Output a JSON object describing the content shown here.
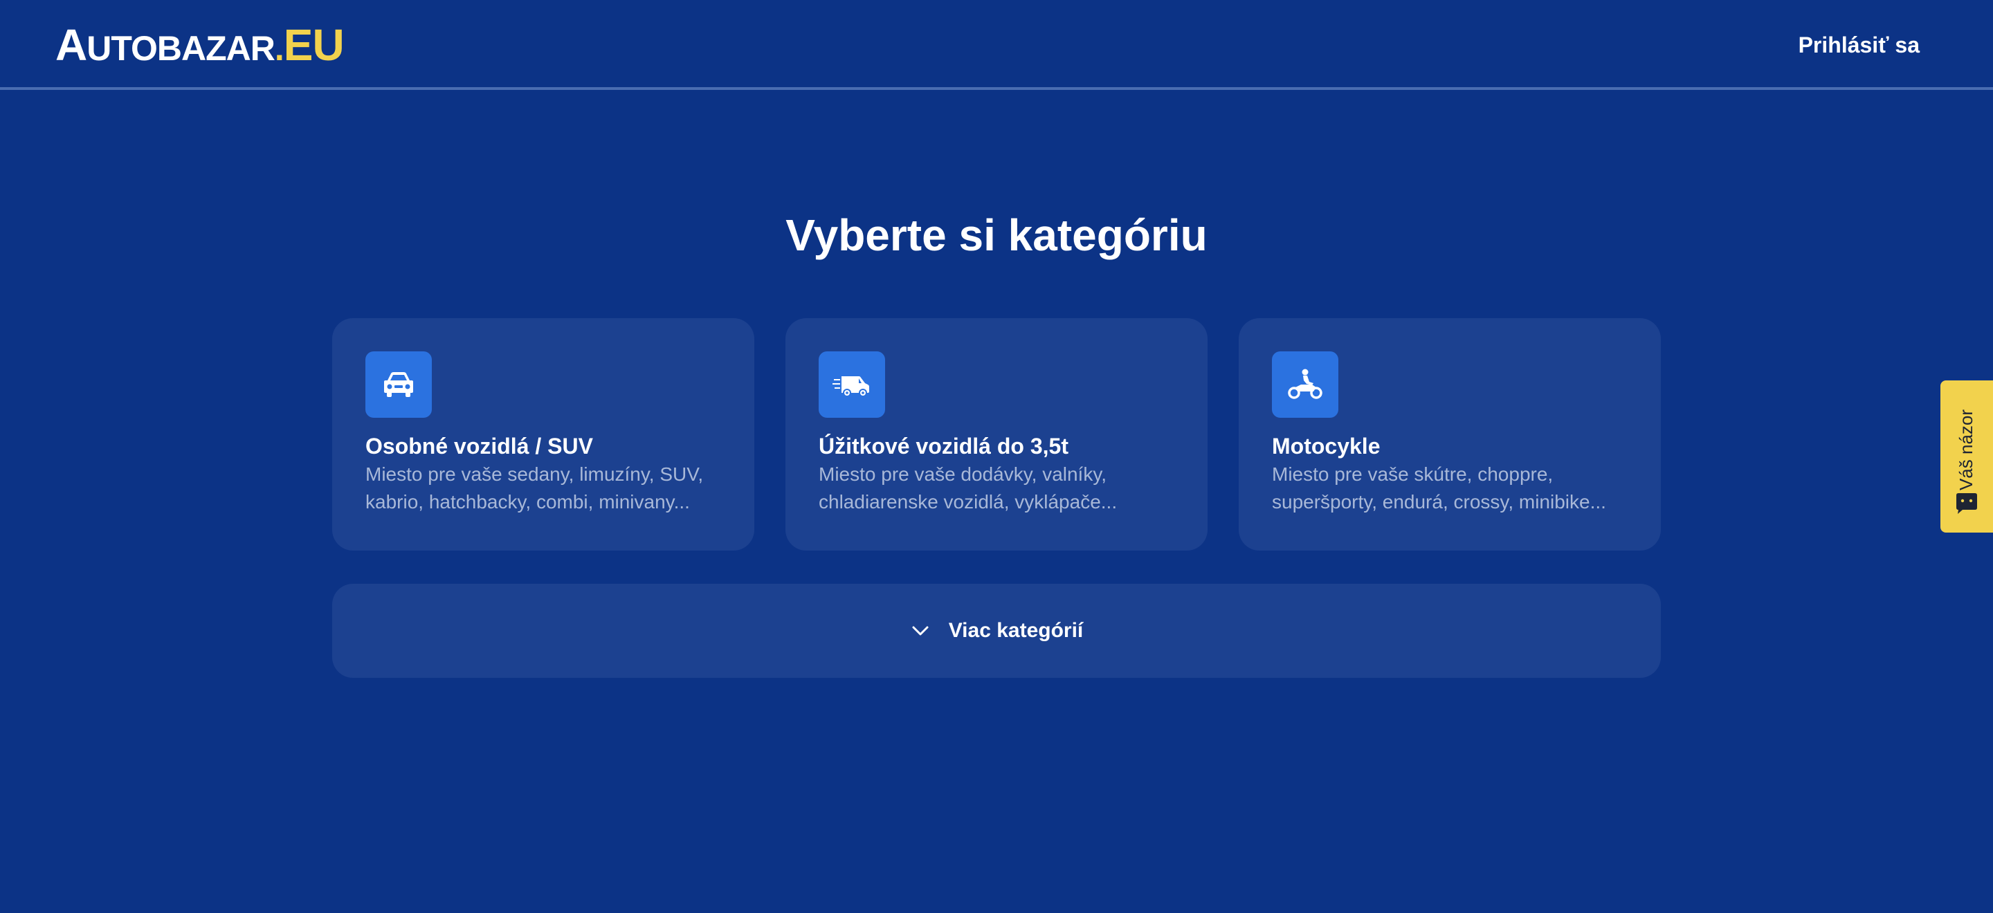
{
  "header": {
    "logo": {
      "cap": "A",
      "rest": "UTOBAZAR",
      "dot": ".",
      "eu": "EU"
    },
    "login_label": "Prihlásiť sa"
  },
  "main": {
    "title": "Vyberte si kategóriu",
    "categories": [
      {
        "icon": "car-icon",
        "title": "Osobné vozidlá / SUV",
        "description": "Miesto pre vaše sedany, limuzíny, SUV, kabrio, hatchbacky, combi, minivany..."
      },
      {
        "icon": "van-icon",
        "title": "Úžitkové vozidlá do 3,5t",
        "description": "Miesto pre vaše dodávky, valníky, chladiarenske vozidlá, vyklápače..."
      },
      {
        "icon": "motorcycle-icon",
        "title": "Motocykle",
        "description": "Miesto pre vaše skútre, choppre, superšporty, endurá, crossy, minibike..."
      }
    ],
    "more_label": "Viac kategórií"
  },
  "feedback": {
    "label": "Váš názor",
    "icon": "chat-icon"
  },
  "colors": {
    "background": "#0c3386",
    "card": "#1c4190",
    "accent_blue": "#2b72e0",
    "brand_yellow": "#f2d24d"
  }
}
